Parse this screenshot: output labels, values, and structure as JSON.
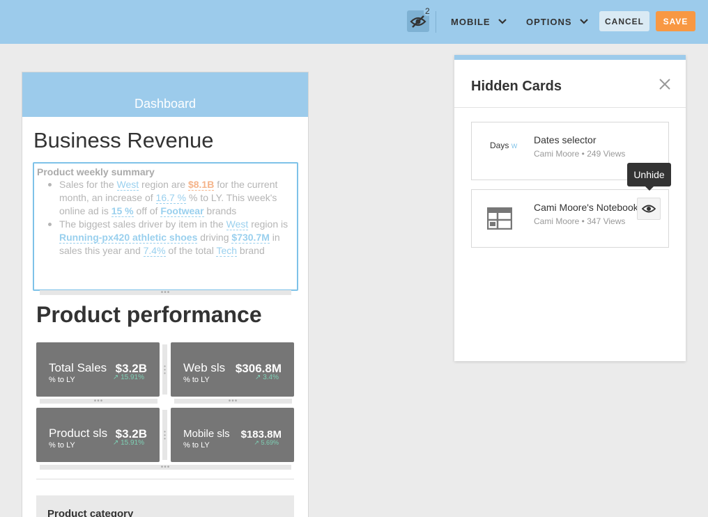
{
  "topbar": {
    "hidden_count": "2",
    "mobile_label": "MOBILE",
    "options_label": "OPTIONS",
    "cancel_label": "CANCEL",
    "save_label": "SAVE",
    "colors": {
      "bar": "#9ccbeb",
      "save": "#f89843"
    }
  },
  "preview": {
    "header": "Dashboard",
    "page_title": "Business Revenue",
    "summary": {
      "title": "Product weekly summary",
      "b1": {
        "t1": "Sales for the ",
        "region": "West",
        "t2": " region are ",
        "amount": "$8.1B",
        "t3": " for the current month, an increase of ",
        "pct": "16.7 %",
        "t4": " % to LY. This week's online ad is ",
        "ad_pct": "15 %",
        "t5": " off of ",
        "brand": "Footwear",
        "t6": " brands"
      },
      "b2": {
        "t1": "The biggest sales driver by item in the ",
        "region": "West",
        "t2": " region is ",
        "item": "Running-px420 athletic shoes",
        "t3": "  driving ",
        "amount": "$730.7M",
        "t4": " in sales this year and ",
        "pct": "7.4%",
        "t5": " of the total ",
        "brand": "Tech",
        "t6": " brand"
      }
    },
    "section_title": "Product performance",
    "kpis": [
      {
        "name": "Total Sales",
        "value": "$3.2B",
        "sub": "% to LY",
        "change": "15.91%"
      },
      {
        "name": "Web sls",
        "value": "$306.8M",
        "sub": "% to LY",
        "change": "3.4%"
      },
      {
        "name": "Product sls",
        "value": "$3.2B",
        "sub": "% to LY",
        "change": "15.91%"
      },
      {
        "name": "Mobile sls",
        "value": "$183.8M",
        "sub": "% to LY",
        "change": "5.69%"
      }
    ],
    "category_title": "Product category"
  },
  "hidden_panel": {
    "title": "Hidden Cards",
    "cards": [
      {
        "thumb_text": "Days",
        "thumb_accent": "W",
        "name": "Dates selector",
        "meta": "Cami Moore • 249 Views"
      },
      {
        "name": "Cami Moore's Notebook",
        "meta": "Cami Moore • 347 Views"
      }
    ],
    "tooltip": "Unhide"
  }
}
